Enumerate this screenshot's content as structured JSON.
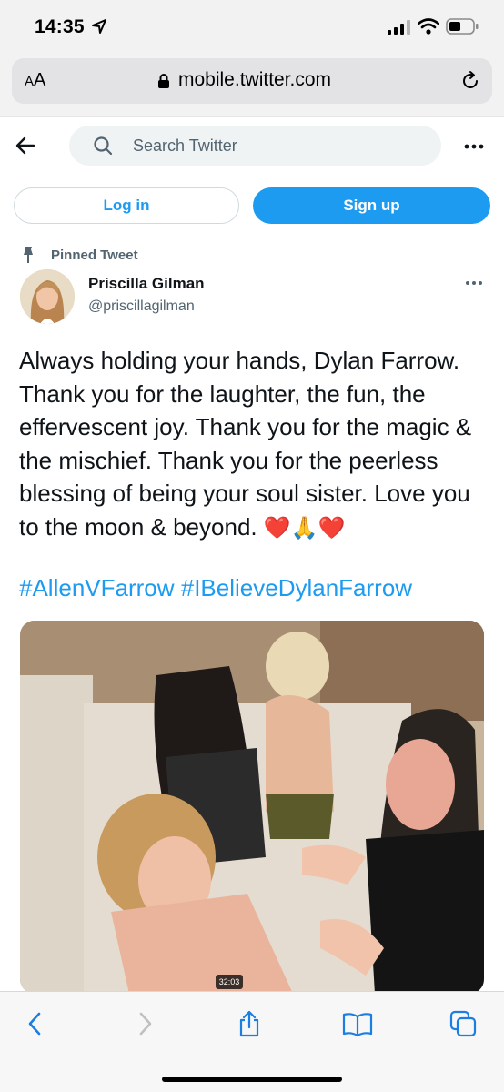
{
  "status_bar": {
    "time": "14:35"
  },
  "browser": {
    "aa_label_small": "A",
    "aa_label_large": "A",
    "url": "mobile.twitter.com"
  },
  "header": {
    "search_placeholder": "Search Twitter"
  },
  "auth": {
    "login_label": "Log in",
    "signup_label": "Sign up"
  },
  "tweet": {
    "pinned_label": "Pinned Tweet",
    "author_name": "Priscilla Gilman",
    "author_handle": "@priscillagilman",
    "text": "Always holding your hands, Dylan Farrow. Thank you for the laughter, the fun, the effervescent joy. Thank you for the magic & the mischief. Thank you for the peerless blessing of being your soul sister.  Love you to the moon & beyond.",
    "emojis": [
      "❤️",
      "🙏",
      "❤️"
    ],
    "hashtags": "#AllenVFarrow #IBelieveDylanFarrow",
    "video_duration": "32:03"
  },
  "colors": {
    "accent": "#1d9bf0",
    "text": "#0f1419",
    "muted": "#536471"
  },
  "icons": [
    "location-arrow-icon",
    "signal-icon",
    "wifi-icon",
    "battery-icon",
    "lock-icon",
    "reload-icon",
    "back-arrow-icon",
    "search-icon",
    "more-icon",
    "pin-icon",
    "share-icon",
    "bookmarks-icon",
    "tabs-icon",
    "chevron-left-icon",
    "chevron-right-icon"
  ]
}
